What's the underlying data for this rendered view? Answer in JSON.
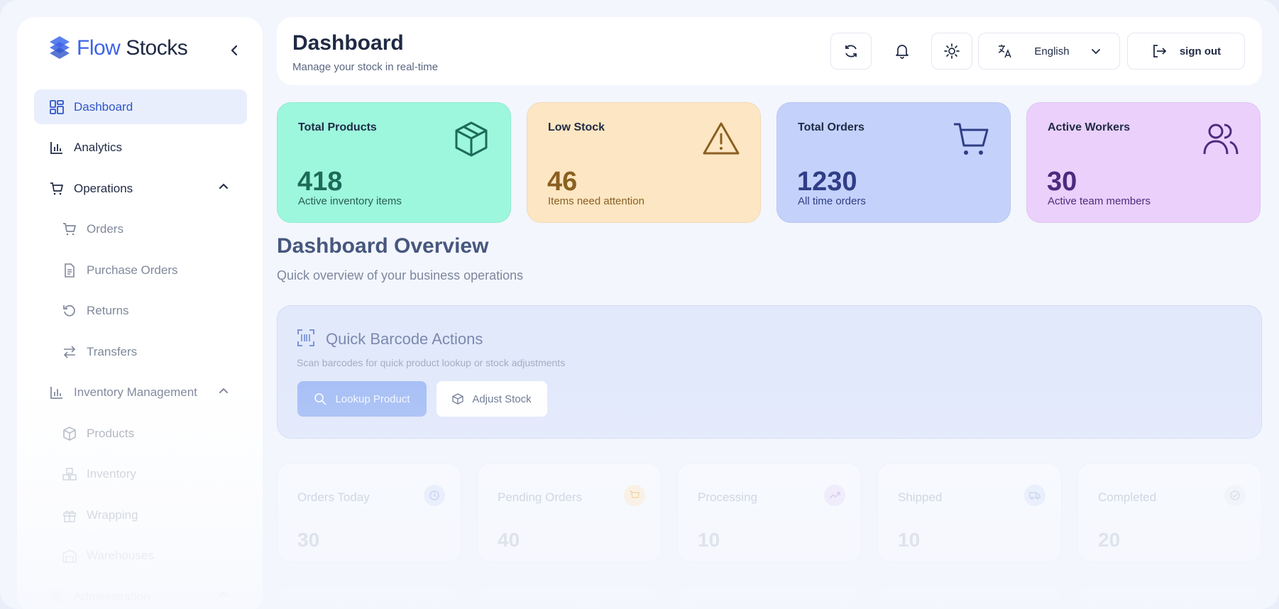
{
  "brand": {
    "part1": "Flow",
    "part2": "Stocks"
  },
  "sidebar": {
    "items": [
      {
        "label": "Dashboard",
        "icon": "dashboard-grid-icon"
      },
      {
        "label": "Analytics",
        "icon": "bar-chart-icon"
      },
      {
        "label": "Operations",
        "icon": "cart-icon"
      },
      {
        "label": "Orders",
        "icon": "cart-icon"
      },
      {
        "label": "Purchase Orders",
        "icon": "document-icon"
      },
      {
        "label": "Returns",
        "icon": "undo-icon"
      },
      {
        "label": "Transfers",
        "icon": "transfer-icon"
      },
      {
        "label": "Inventory Management",
        "icon": "bar-chart-icon"
      },
      {
        "label": "Products",
        "icon": "box-icon"
      },
      {
        "label": "Inventory",
        "icon": "boxes-icon"
      },
      {
        "label": "Wrapping",
        "icon": "gift-icon"
      },
      {
        "label": "Warehouses",
        "icon": "warehouse-icon"
      },
      {
        "label": "Administration",
        "icon": "settings-icon"
      }
    ]
  },
  "header": {
    "title": "Dashboard",
    "subtitle": "Manage your stock in real-time",
    "language": "English",
    "signout": "sign out"
  },
  "stats": [
    {
      "title": "Total Products",
      "value": "418",
      "caption": "Active inventory items",
      "icon": "package-icon",
      "bg": "#9cf7dd",
      "value_color": "#1d6b58",
      "caption_color": "#2a5f50"
    },
    {
      "title": "Low Stock",
      "value": "46",
      "caption": "Items need attention",
      "icon": "warning-triangle-icon",
      "bg": "#fde6c3",
      "value_color": "#8a6022",
      "caption_color": "#8a6022"
    },
    {
      "title": "Total Orders",
      "value": "1230",
      "caption": "All time orders",
      "icon": "cart-icon",
      "bg": "#c4d1fb",
      "value_color": "#2f3e86",
      "caption_color": "#2f3e86"
    },
    {
      "title": "Active Workers",
      "value": "30",
      "caption": "Active team members",
      "icon": "users-icon",
      "bg": "#ead0fb",
      "value_color": "#4c2b7e",
      "caption_color": "#4c2b7e"
    }
  ],
  "overview": {
    "title": "Dashboard Overview",
    "subtitle": "Quick overview of your business operations"
  },
  "barcode": {
    "title": "Quick Barcode Actions",
    "subtitle": "Scan barcodes for quick product lookup or stock adjustments",
    "lookup_label": "Lookup Product",
    "adjust_label": "Adjust Stock"
  },
  "order_stats": [
    {
      "label": "Orders Today",
      "value": "30",
      "icon": "clock-icon",
      "tint": "#e6ecfb"
    },
    {
      "label": "Pending Orders",
      "value": "40",
      "icon": "cart-icon",
      "tint": "#fcefdc"
    },
    {
      "label": "Processing",
      "value": "10",
      "icon": "trend-up-icon",
      "tint": "#efe8fb"
    },
    {
      "label": "Shipped",
      "value": "10",
      "icon": "truck-icon",
      "tint": "#e6ecfb"
    },
    {
      "label": "Completed",
      "value": "20",
      "icon": "check-circle-icon",
      "tint": "#f1f3f7"
    }
  ]
}
